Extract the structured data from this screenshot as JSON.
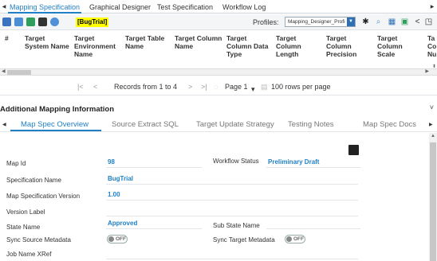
{
  "top_tabs": [
    "Mapping Specification",
    "Graphical Designer",
    "Test Specification",
    "Workflow Log"
  ],
  "badge": "[BugTrial]",
  "profiles": {
    "label": "Profiles:",
    "selected": "Mapping_Designer_Profi"
  },
  "columns": [
    "#",
    "Target System Name",
    "Target Environment Name",
    "Target Table Name",
    "Target Column Name",
    "Target Column Data Type",
    "Target Column Length",
    "Target Column Precision",
    "Target Column Scale",
    "Ta Co Nu"
  ],
  "pager": {
    "records": "Records from 1 to 4",
    "page": "Page 1",
    "rows": "100 rows per page"
  },
  "section_title": "Additional Mapping Information",
  "sub_tabs": [
    "Map Spec Overview",
    "Source Extract SQL",
    "Target Update Strategy",
    "Testing Notes",
    "Map Spec Docs"
  ],
  "form": {
    "map_id_label": "Map Id",
    "map_id": "98",
    "workflow_status_label": "Workflow Status",
    "workflow_status": "Preliminary Draft",
    "spec_name_label": "Specification Name",
    "spec_name": "BugTrial",
    "spec_version_label": "Map Specification Version",
    "spec_version": "1.00",
    "version_label_label": "Version Label",
    "state_name_label": "State Name",
    "state_name": "Approved",
    "sub_state_label": "Sub State Name",
    "sync_source_label": "Sync Source Metadata",
    "sync_source": "OFF",
    "sync_target_label": "Sync Target Metadata",
    "sync_target": "OFF",
    "job_xref_label": "Job Name XRef"
  },
  "colors": {
    "accent": "#1f7fc7",
    "badge": "#ffff00"
  }
}
